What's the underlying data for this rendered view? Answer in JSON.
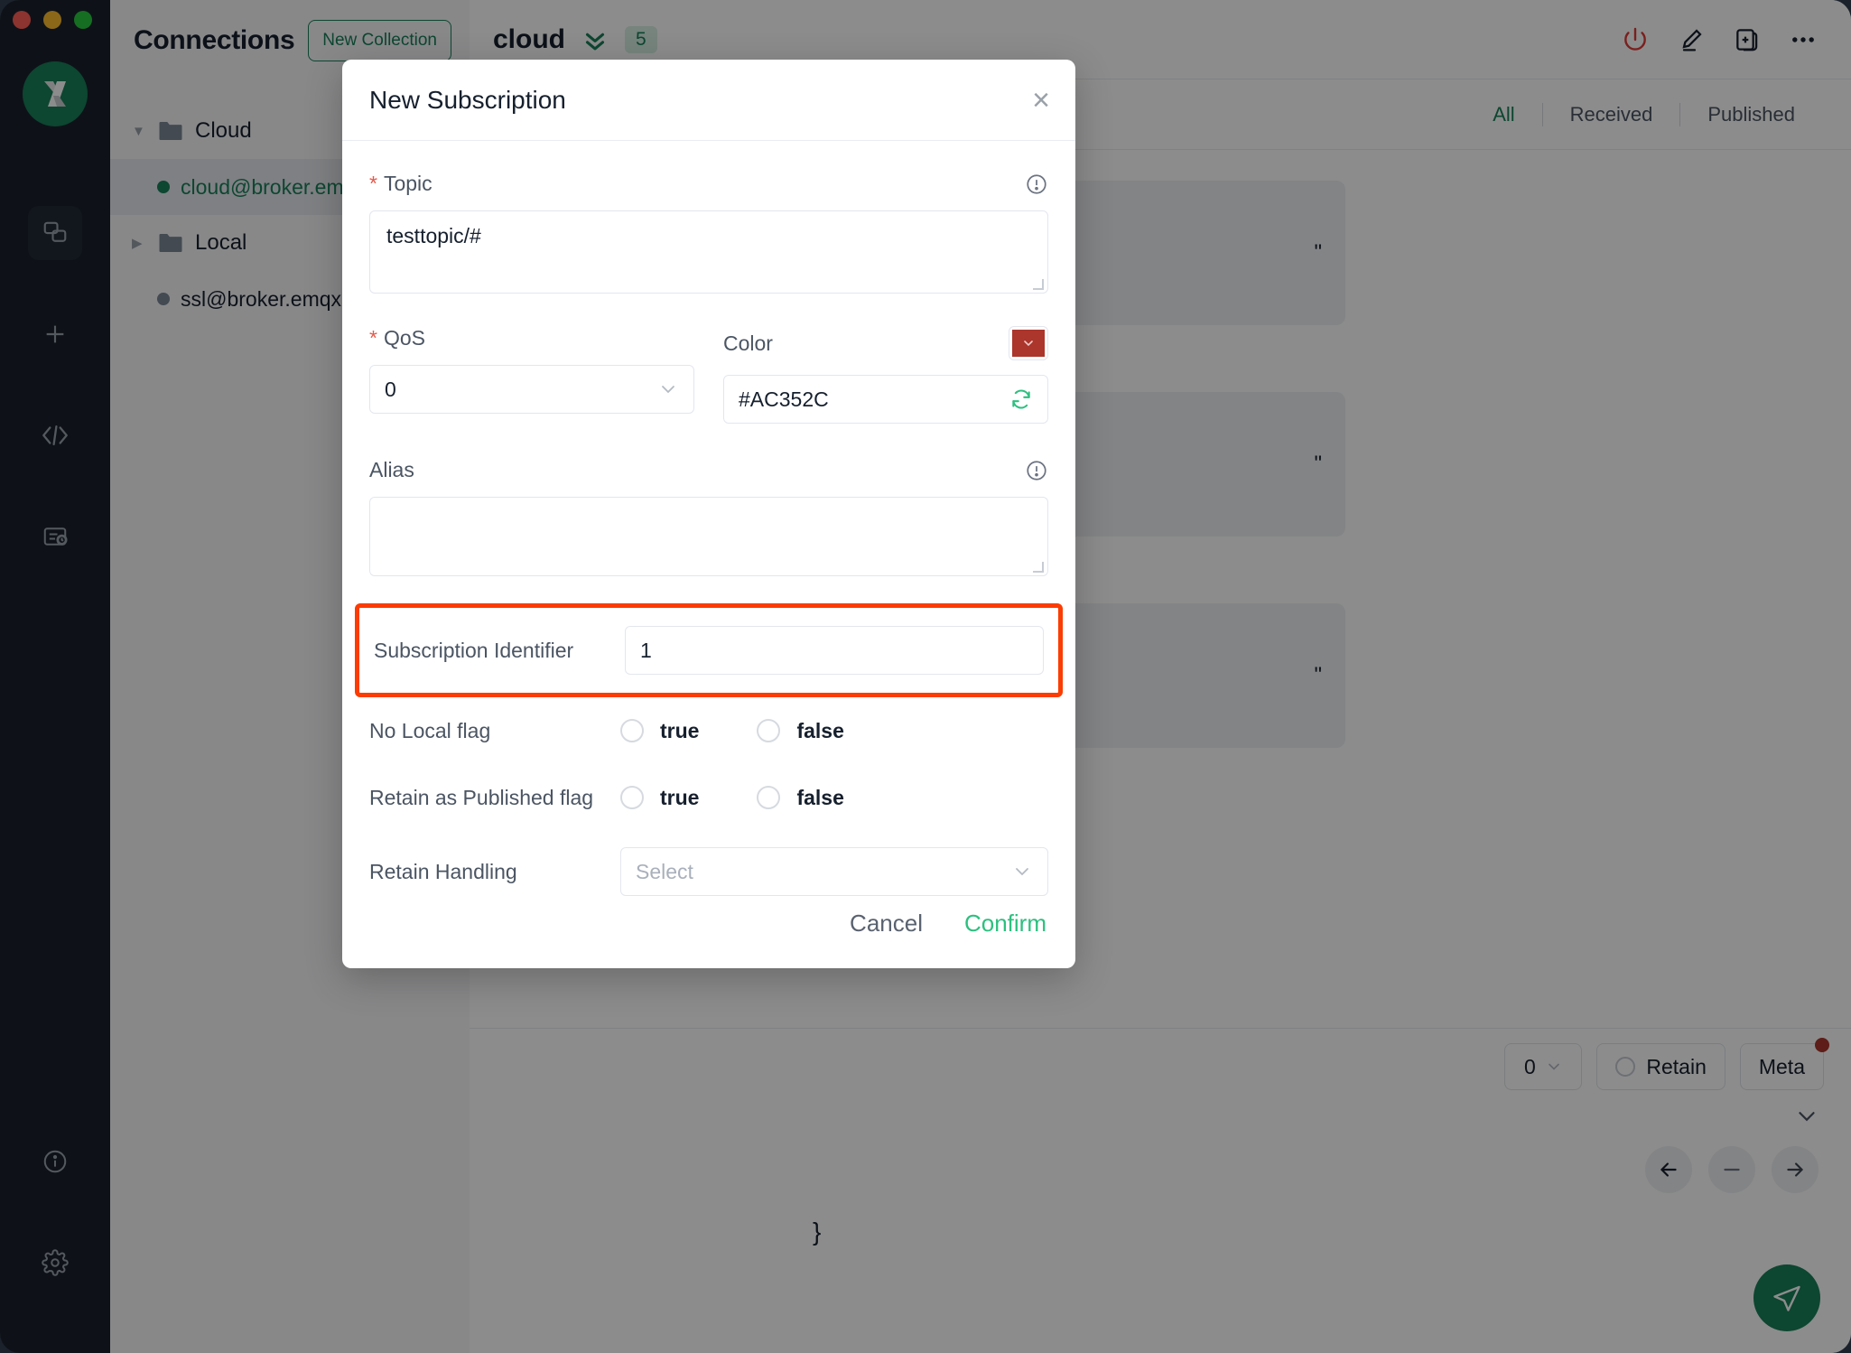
{
  "window": {
    "traffic_lights": [
      "close",
      "minimize",
      "maximize"
    ]
  },
  "rail": {
    "logo_name": "mqttx-logo",
    "items": [
      {
        "name": "connections-icon",
        "label": "Connections"
      },
      {
        "name": "new-connection-icon",
        "label": "New Connection"
      },
      {
        "name": "script-icon",
        "label": "Scripts"
      },
      {
        "name": "log-icon",
        "label": "Log"
      }
    ],
    "bottom_items": [
      {
        "name": "about-icon",
        "label": "About"
      },
      {
        "name": "settings-icon",
        "label": "Settings"
      }
    ]
  },
  "connections": {
    "title": "Connections",
    "new_collection_label": "New Collection",
    "tree": [
      {
        "type": "folder",
        "label": "Cloud",
        "expanded": true
      },
      {
        "type": "connection",
        "label": "cloud@broker.emqx.io",
        "status": "connected",
        "selected": true
      },
      {
        "type": "folder",
        "label": "Local",
        "expanded": false
      },
      {
        "type": "connection",
        "label": "ssl@broker.emqx.io",
        "status": "disconnected",
        "selected": false
      }
    ]
  },
  "main": {
    "title": "cloud",
    "subscription_count": "5",
    "header_icons": [
      {
        "name": "power-icon",
        "label": "Disconnect"
      },
      {
        "name": "edit-icon",
        "label": "Edit"
      },
      {
        "name": "new-window-icon",
        "label": "New Window"
      },
      {
        "name": "more-icon",
        "label": "More"
      }
    ],
    "filters": [
      {
        "label": "All",
        "active": true
      },
      {
        "label": "Received",
        "active": false
      },
      {
        "label": "Published",
        "active": false
      }
    ],
    "messages": [
      {
        "text": "\""
      },
      {
        "text": "\""
      },
      {
        "text": "\""
      }
    ],
    "editor": {
      "payload_preview": "}",
      "qos_value": "0",
      "retain_label": "Retain",
      "meta_label": "Meta",
      "meta_has_badge": true,
      "nav_buttons": [
        {
          "name": "prev-arrow-icon",
          "label": "Previous"
        },
        {
          "name": "minus-icon",
          "label": "Collapse"
        },
        {
          "name": "next-arrow-icon",
          "label": "Next"
        }
      ],
      "send_label": "Send"
    }
  },
  "modal": {
    "title": "New Subscription",
    "close_label": "×",
    "topic": {
      "label": "Topic",
      "required": true,
      "value": "testtopic/#",
      "has_info": true
    },
    "qos": {
      "label": "QoS",
      "required": true,
      "value": "0"
    },
    "color": {
      "label": "Color",
      "value": "#AC352C",
      "swatch_hex": "#AC352C",
      "refresh_icon": "sync-icon"
    },
    "alias": {
      "label": "Alias",
      "value": "",
      "has_info": true
    },
    "subscription_identifier": {
      "label": "Subscription Identifier",
      "value": "1",
      "highlighted": true,
      "highlight_color": "#FC3C00"
    },
    "no_local_flag": {
      "label": "No Local flag",
      "options": [
        "true",
        "false"
      ],
      "selected": null
    },
    "retain_as_published_flag": {
      "label": "Retain as Published flag",
      "options": [
        "true",
        "false"
      ],
      "selected": null
    },
    "retain_handling": {
      "label": "Retain Handling",
      "placeholder": "Select",
      "value": ""
    },
    "footer": {
      "cancel_label": "Cancel",
      "confirm_label": "Confirm"
    }
  }
}
